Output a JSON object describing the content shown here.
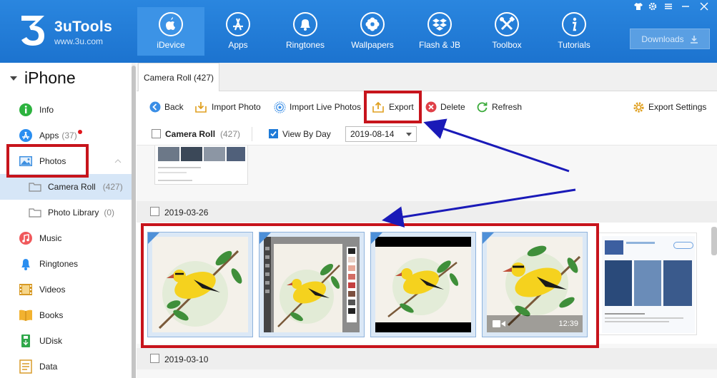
{
  "app": {
    "name": "3uTools",
    "url": "www.3u.com"
  },
  "nav": [
    {
      "label": "iDevice",
      "icon": "apple-icon",
      "active": true
    },
    {
      "label": "Apps",
      "icon": "app-store-icon"
    },
    {
      "label": "Ringtones",
      "icon": "bell-icon"
    },
    {
      "label": "Wallpapers",
      "icon": "flower-icon"
    },
    {
      "label": "Flash & JB",
      "icon": "dropbox-icon"
    },
    {
      "label": "Toolbox",
      "icon": "tools-icon"
    },
    {
      "label": "Tutorials",
      "icon": "info-icon"
    }
  ],
  "downloads_label": "Downloads",
  "sidebar": {
    "device": "iPhone",
    "items": [
      {
        "label": "Info",
        "icon": "info-circle-icon"
      },
      {
        "label": "Apps",
        "count": "(37)",
        "icon": "app-store-icon"
      },
      {
        "label": "Photos",
        "icon": "photo-icon"
      },
      {
        "label": "Camera Roll",
        "count": "(427)",
        "icon": "folder-icon"
      },
      {
        "label": "Photo Library",
        "count": "(0)",
        "icon": "folder-icon"
      },
      {
        "label": "Music",
        "icon": "music-icon"
      },
      {
        "label": "Ringtones",
        "icon": "bell-icon"
      },
      {
        "label": "Videos",
        "icon": "film-icon"
      },
      {
        "label": "Books",
        "icon": "book-icon"
      },
      {
        "label": "UDisk",
        "icon": "usb-icon"
      },
      {
        "label": "Data",
        "icon": "data-icon"
      }
    ]
  },
  "tab": {
    "label": "Camera Roll (427)"
  },
  "toolbar": {
    "back": "Back",
    "import_photo": "Import Photo",
    "import_live": "Import Live Photos",
    "export": "Export",
    "delete": "Delete",
    "refresh": "Refresh",
    "export_settings": "Export Settings"
  },
  "filter": {
    "album_label": "Camera Roll",
    "album_count": "(427)",
    "view_by_day": "View By Day",
    "view_by_day_checked": true,
    "date": "2019-08-14"
  },
  "sections": [
    {
      "date": "2019-03-26"
    },
    {
      "date": "2019-03-10"
    }
  ],
  "video_duration": "12:39",
  "colors": {
    "accent": "#1e7bd8",
    "highlight": "#c7141c",
    "arrow": "#1a1ab8"
  }
}
